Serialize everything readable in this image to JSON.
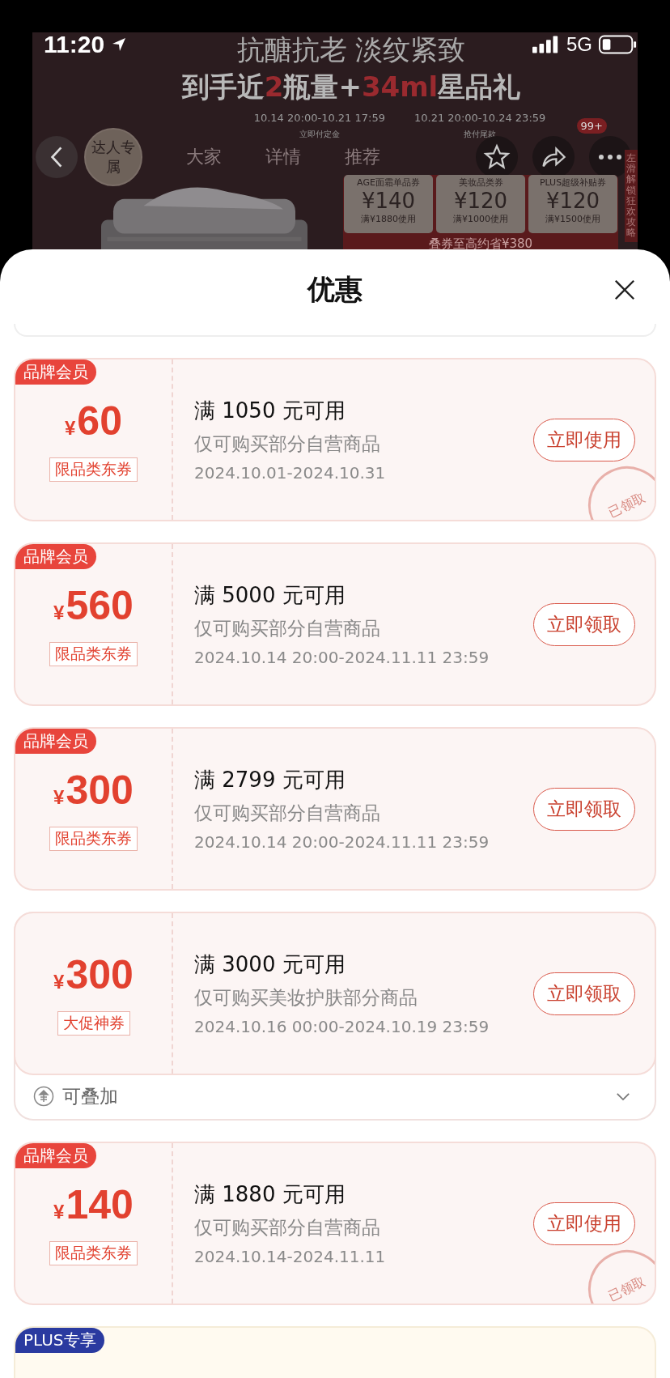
{
  "status_bar": {
    "time": "11:20",
    "network": "5G"
  },
  "banner": {
    "slogan": "抗醣抗老 淡纹紧致",
    "headline": "到手近**2**瓶量+**34ml**星品礼",
    "badge": "达人专属",
    "phases": [
      {
        "time": "10.14 20:00-10.21 17:59",
        "label": "立即付定金"
      },
      {
        "time": "10.21 20:00-10.24 23:59",
        "label": "抢付尾款"
      }
    ],
    "tabs": [
      "大家",
      "详情",
      "推荐"
    ],
    "mini_coupons": [
      {
        "name": "AGE面霜单品券",
        "amount": "¥140",
        "rule": "满¥1880使用"
      },
      {
        "name": "美妆品类券",
        "amount": "¥120",
        "rule": "满¥1000使用"
      },
      {
        "name": "PLUS超级补贴券",
        "amount": "¥120",
        "rule": "满¥1500使用"
      }
    ],
    "total": "叠券至高约省¥380",
    "count_badge": "99+",
    "side_strip": "左滑解锁狂欢攻略"
  },
  "sheet": {
    "title": "优惠"
  },
  "coupons": [
    {
      "kind": "coupon",
      "tag": "品牌会员",
      "color": "#e8453c",
      "currency": "¥",
      "amount": "60",
      "label": "限品类东券",
      "condition": "满 1050 元可用",
      "scope": "仅可购买部分自营商品",
      "period": "2024.10.01-2024.10.31",
      "button": "立即使用",
      "stamp": "已领取"
    },
    {
      "kind": "coupon",
      "tag": "品牌会员",
      "color": "#e8453c",
      "currency": "¥",
      "amount": "560",
      "label": "限品类东券",
      "condition": "满 5000 元可用",
      "scope": "仅可购买部分自营商品",
      "period": "2024.10.14 20:00-2024.11.11 23:59",
      "button": "立即领取"
    },
    {
      "kind": "coupon",
      "tag": "品牌会员",
      "color": "#e8453c",
      "currency": "¥",
      "amount": "300",
      "label": "限品类东券",
      "condition": "满 2799 元可用",
      "scope": "仅可购买部分自营商品",
      "period": "2024.10.14 20:00-2024.11.11 23:59",
      "button": "立即领取"
    },
    {
      "kind": "coupon",
      "currency": "¥",
      "amount": "300",
      "label": "大促神券",
      "condition": "满 3000 元可用",
      "scope": "仅可购买美妆护肤部分商品",
      "period": "2024.10.16 00:00-2024.10.19 23:59",
      "button": "立即领取",
      "stack_note": "可叠加"
    },
    {
      "kind": "coupon",
      "tag": "品牌会员",
      "color": "#e8453c",
      "currency": "¥",
      "amount": "140",
      "label": "限品类东券",
      "condition": "满 1880 元可用",
      "scope": "仅可购买部分自营商品",
      "period": "2024.10.14-2024.11.11",
      "button": "立即使用",
      "stamp": "已领取"
    },
    {
      "kind": "partial",
      "tag": "PLUS专享",
      "color": "#2a3aa0"
    }
  ]
}
